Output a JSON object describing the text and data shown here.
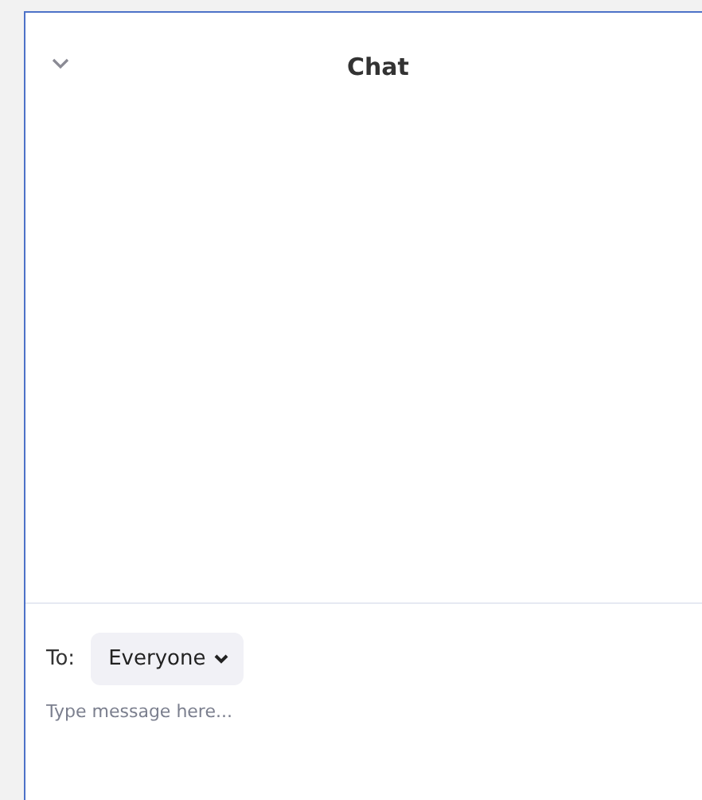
{
  "panel": {
    "title": "Chat"
  },
  "composer": {
    "to_label": "To:",
    "recipient": "Everyone",
    "placeholder": "Type message here..."
  }
}
